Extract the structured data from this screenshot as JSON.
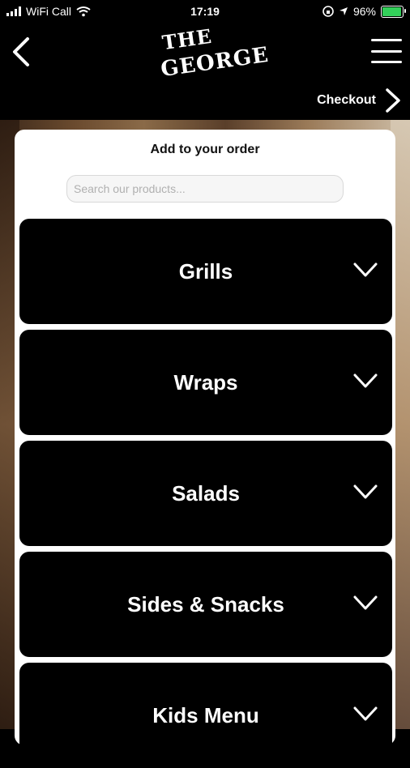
{
  "status": {
    "carrier": "WiFi Call",
    "time": "17:19",
    "battery": "96%",
    "battery_level": 0.96,
    "wifi_icon": "wifi-icon",
    "location_icon": "location-arrow-icon"
  },
  "header": {
    "logo_line1": "THE",
    "logo_line2": "GEORGE",
    "checkout_label": "Checkout"
  },
  "card": {
    "title": "Add to your order",
    "search_placeholder": "Search our products..."
  },
  "categories": [
    {
      "label": "Grills"
    },
    {
      "label": "Wraps"
    },
    {
      "label": "Salads"
    },
    {
      "label": "Sides & Snacks"
    },
    {
      "label": "Kids Menu"
    }
  ]
}
